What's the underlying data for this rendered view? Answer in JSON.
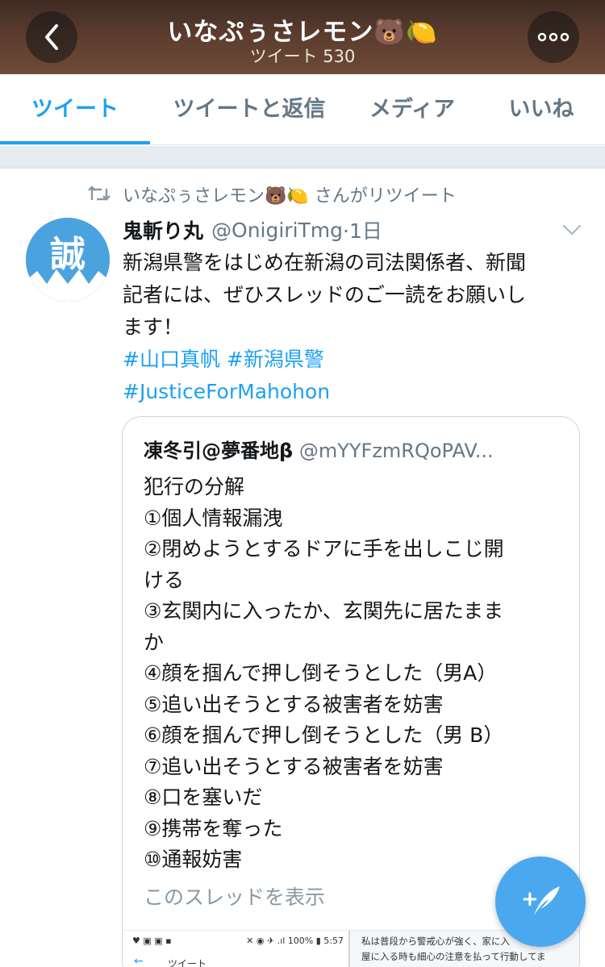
{
  "header": {
    "title": "いなぷぅさレモン🐻🍋",
    "subtitle": "ツイート 530",
    "back_icon": "chevron-left-icon",
    "more_icon": "more-horizontal-icon"
  },
  "tabs": [
    {
      "label": "ツイート",
      "active": true
    },
    {
      "label": "ツイートと返信",
      "active": false
    },
    {
      "label": "メディア",
      "active": false
    },
    {
      "label": "いいね",
      "active": false
    }
  ],
  "tweet": {
    "retweet_label": "いなぷぅさレモン🐻🍋 さんがリツイート",
    "avatar_char": "誠",
    "name": "鬼斬り丸",
    "handle": "@OnigiriTmg",
    "time": "·1日",
    "text_line1": "新潟県警をはじめ在新潟の司法関係者、新聞",
    "text_line2": "記者には、ぜひスレッドのご一読をお願いし",
    "text_line3": "ます！",
    "hashtag1": "#山口真帆",
    "hashtag2": "#新潟県警",
    "hashtag3": "#JusticeForMahohon"
  },
  "quote": {
    "name": "凍冬引@夢番地β",
    "handle": "@mYYFzmRQoPAV...",
    "lines": [
      "犯行の分解",
      "①個人情報漏洩",
      "②閉めようとするドアに手を出しこじ開",
      "ける",
      "③玄関内に入ったか、玄関先に居たまま",
      "か",
      "④顔を掴んで押し倒そうとした（男A）",
      "⑤追い出そうとする被害者を妨害",
      "⑥顔を掴んで押し倒そうとした（男 B）",
      "⑦追い出そうとする被害者を妨害",
      "⑧口を塞いだ",
      "⑨携帯を奪った",
      "⑩通報妨害"
    ],
    "show_thread": "このスレッドを表示",
    "media": {
      "status_left": "♥ ▣ ▣ ▪",
      "status_right": "✕ ◉ ✈ .ıl 100% ▮ 5:57",
      "back_label": "ツイート",
      "right_line1": "私は普段から警戒心が強く、家に入",
      "right_line2": "屋に入る時も細心の注意を払って行動してま"
    }
  },
  "fab": {
    "icon": "compose-tweet-icon",
    "plus": "+"
  },
  "colors": {
    "accent": "#1da1f2",
    "secondary_text": "#657786",
    "header_bg": "#5a3c2e"
  }
}
